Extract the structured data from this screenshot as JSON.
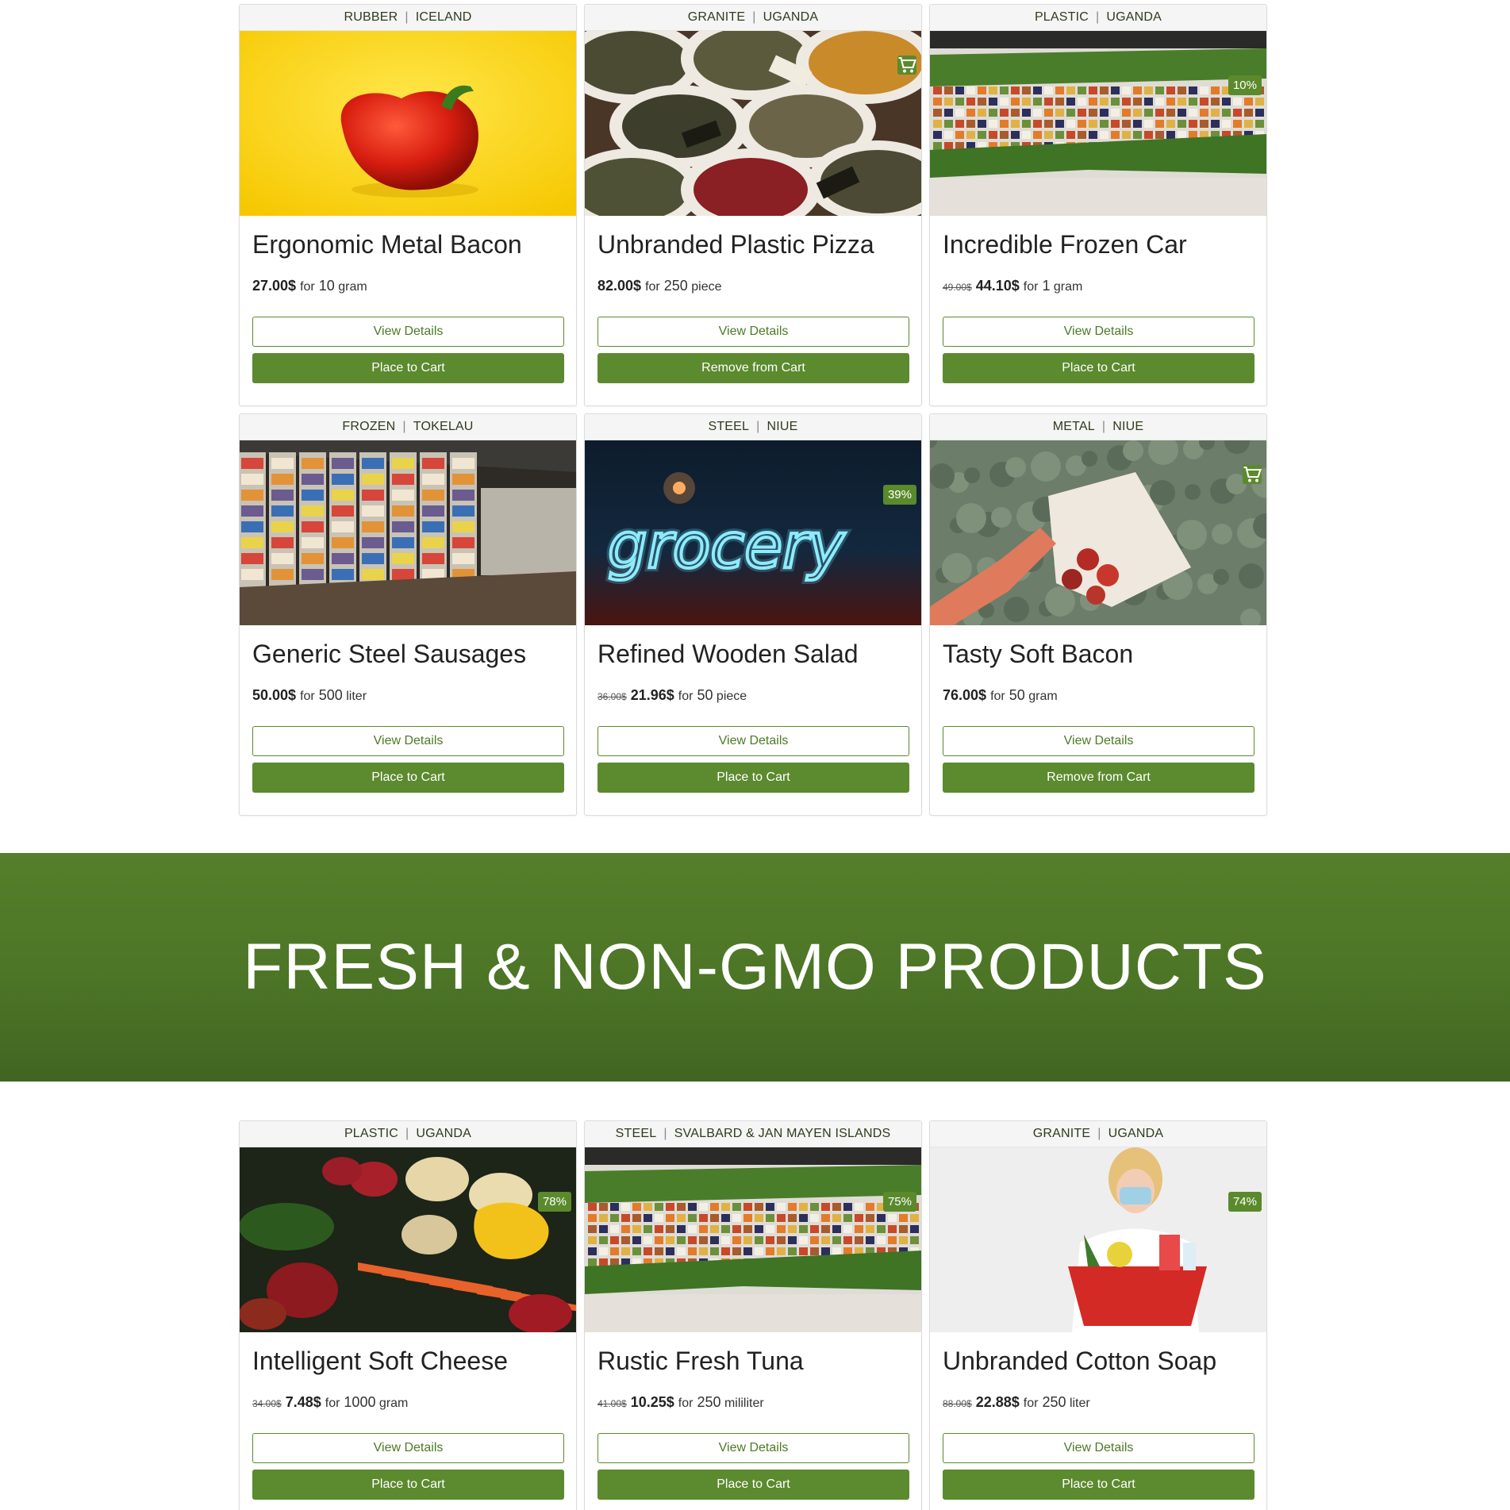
{
  "banner": {
    "title": "FRESH & NON-GMO PRODUCTS"
  },
  "labels": {
    "view": "View Details",
    "place": "Place to Cart",
    "remove": "Remove from Cart"
  },
  "colors": {
    "brand": "#5c8a2e",
    "banner": "#4c7526"
  },
  "top_products": [
    {
      "material": "RUBBER",
      "country": "ICELAND",
      "title": "Ergonomic Metal Bacon",
      "old_price": "",
      "price": "27.00$",
      "for": "for",
      "qty": "10",
      "unit": "gram",
      "discount": "",
      "in_cart": false,
      "image": "red-pepper-yellow-background"
    },
    {
      "material": "GRANITE",
      "country": "UGANDA",
      "title": "Unbranded Plastic Pizza",
      "old_price": "",
      "price": "82.00$",
      "for": "for",
      "qty": "250",
      "unit": "piece",
      "discount": "",
      "in_cart": true,
      "image": "spice-sacks"
    },
    {
      "material": "PLASTIC",
      "country": "UGANDA",
      "title": "Incredible Frozen Car",
      "old_price": "49.00$",
      "price": "44.10$",
      "for": "for",
      "qty": "1",
      "unit": "gram",
      "discount": "10%",
      "in_cart": false,
      "image": "grocery-aisle-greenery"
    },
    {
      "material": "FROZEN",
      "country": "TOKELAU",
      "title": "Generic Steel Sausages",
      "old_price": "",
      "price": "50.00$",
      "for": "for",
      "qty": "500",
      "unit": "liter",
      "discount": "",
      "in_cart": false,
      "image": "freezer-aisle"
    },
    {
      "material": "STEEL",
      "country": "NIUE",
      "title": "Refined Wooden Salad",
      "old_price": "36.00$",
      "price": "21.96$",
      "for": "for",
      "qty": "50",
      "unit": "piece",
      "discount": "39%",
      "in_cart": false,
      "image": "grocery-neon-sign"
    },
    {
      "material": "METAL",
      "country": "NIUE",
      "title": "Tasty Soft Bacon",
      "old_price": "",
      "price": "76.00$",
      "for": "for",
      "qty": "50",
      "unit": "gram",
      "discount": "",
      "in_cart": true,
      "image": "apple-tote-bag"
    }
  ],
  "bottom_products": [
    {
      "material": "PLASTIC",
      "country": "UGANDA",
      "title": "Intelligent Soft Cheese",
      "old_price": "34.00$",
      "price": "7.48$",
      "for": "for",
      "qty": "1000",
      "unit": "gram",
      "discount": "78%",
      "in_cart": false,
      "image": "mixed-vegetables"
    },
    {
      "material": "STEEL",
      "country": "SVALBARD & JAN MAYEN ISLANDS",
      "title": "Rustic Fresh Tuna",
      "old_price": "41.00$",
      "price": "10.25$",
      "for": "for",
      "qty": "250",
      "unit": "mililiter",
      "discount": "75%",
      "in_cart": false,
      "image": "grocery-aisle-greenery"
    },
    {
      "material": "GRANITE",
      "country": "UGANDA",
      "title": "Unbranded Cotton Soap",
      "old_price": "88.00$",
      "price": "22.88$",
      "for": "for",
      "qty": "250",
      "unit": "liter",
      "discount": "74%",
      "in_cart": false,
      "image": "woman-with-basket"
    }
  ]
}
